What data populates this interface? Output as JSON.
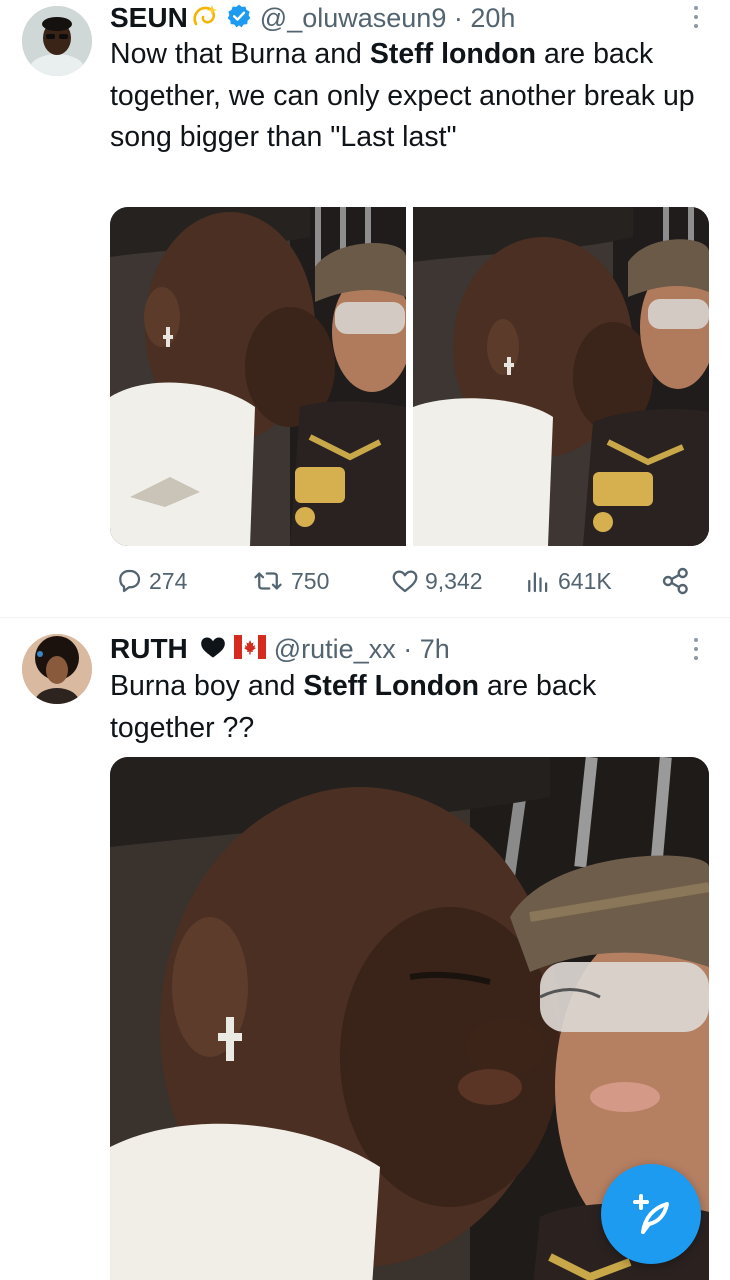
{
  "tweets": [
    {
      "name": "SEUN",
      "name_emoji": "dizzy-emoji",
      "verified": true,
      "handle": "@_oluwaseun9 · 20h",
      "text_parts": [
        "Now that Burna and ",
        "Steff london",
        " are back together, we can only expect another break up song bigger than \"Last last\""
      ],
      "media_count": 2,
      "stats": {
        "replies": "274",
        "retweets": "750",
        "likes": "9,342",
        "views": "641K"
      }
    },
    {
      "name": "RUTH",
      "name_icons": [
        "heart-icon",
        "canada-flag-icon"
      ],
      "handle": "@rutie_xx · 7h",
      "text_parts": [
        "Burna boy and ",
        "Steff London",
        " are back together ??"
      ],
      "media_count": 1
    }
  ],
  "icons": {
    "reply": "reply-icon",
    "retweet": "retweet-icon",
    "like": "like-icon",
    "views": "views-icon",
    "share": "share-icon",
    "compose": "compose-tweet-icon",
    "more": "more-options-icon"
  },
  "colors": {
    "accent": "#1d9bf0",
    "text": "#0f1419",
    "secondary": "#536471",
    "divider": "#eff3f4"
  }
}
